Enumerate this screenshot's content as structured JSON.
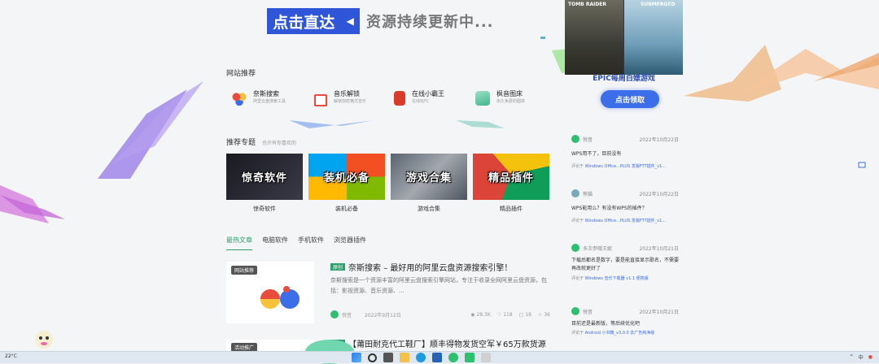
{
  "banner": {
    "button_label": "点击直达",
    "subtitle": "资源持续更新中..."
  },
  "site_section": {
    "title": "网站推荐"
  },
  "sites": [
    {
      "name": "奈斯搜索",
      "desc": "阿里云盘搜索工具"
    },
    {
      "name": "音乐解锁",
      "desc": "解锁加密格式音乐"
    },
    {
      "name": "在线小霸王",
      "desc": "在线玩FC"
    },
    {
      "name": "枫音图床",
      "desc": "永久免费的图床"
    }
  ],
  "topics_section": {
    "title": "推荐专题",
    "subtitle": "也许有你喜欢的"
  },
  "topics": [
    {
      "image_text": "惊奇软件",
      "caption": "惊奇软件"
    },
    {
      "image_text": "装机必备",
      "caption": "装机必备"
    },
    {
      "image_text": "游戏合集",
      "caption": "游戏合集"
    },
    {
      "image_text": "精品插件",
      "caption": "精品插件"
    }
  ],
  "tabs": [
    {
      "label": "最热文章",
      "active": true
    },
    {
      "label": "电脑软件",
      "active": false
    },
    {
      "label": "手机软件",
      "active": false
    },
    {
      "label": "浏览器插件",
      "active": false
    }
  ],
  "post1": {
    "badge": "网站推荐",
    "tag": "原创",
    "title": "奈斯搜索 – 最好用的阿里云盘资源搜索引擎！",
    "excerpt": "奈斯搜索是一个资源丰富的阿里云盘搜索引擎网站，专注于收录全网阿里云盘资源，包括：影视资源、音乐资源、...",
    "author": "悦音",
    "date": "2022年9月12日",
    "views": "28.3K",
    "likes": "118",
    "comments": "18",
    "stars": "36"
  },
  "post2": {
    "badge": "活动推广",
    "tag": "原创",
    "title": "【莆田耐克代工鞋厂】顺丰得物发货空军￥65万款货源"
  },
  "ad": {
    "game1": "TOMB RAIDER",
    "game2": "SUBMERGED",
    "caption": "EPIC每周白嫖游戏",
    "button": "点击领取"
  },
  "comments": [
    {
      "user": "悦音",
      "date": "2022年10月22日",
      "body": "WPS用不了，目前没有",
      "source_prefix": "评论于",
      "source": "Windows Office...PLUS 发版FTT插件_v1...",
      "avatar_color": "#2fbf71"
    },
    {
      "user": "熊猫",
      "date": "2022年10月22日",
      "body": "WPS能用么？有没有WPS的插件？",
      "source_prefix": "评论于",
      "source": "Windows Office...PLUS 发版FTT插件_v1...",
      "avatar_color": "#7ab"
    },
    {
      "user": "多次参哦王妮",
      "date": "2022年10月21日",
      "body": "下载后都名是数字，要是能直接显示歌名，不需要再改就更好了",
      "source_prefix": "评论于",
      "source": "Windows 音乐下载器 v1.1 便携版",
      "avatar_color": "#2fbf71"
    },
    {
      "user": "悦音",
      "date": "2022年10月21日",
      "body": "目前还是最新版，等后续优化吧",
      "source_prefix": "评论于",
      "source": "Android 小书籍_v3.0.0 去广告纯净版",
      "avatar_color": "#2fbf71"
    }
  ],
  "taskbar": {
    "weather": "22°C",
    "lang": "中"
  }
}
